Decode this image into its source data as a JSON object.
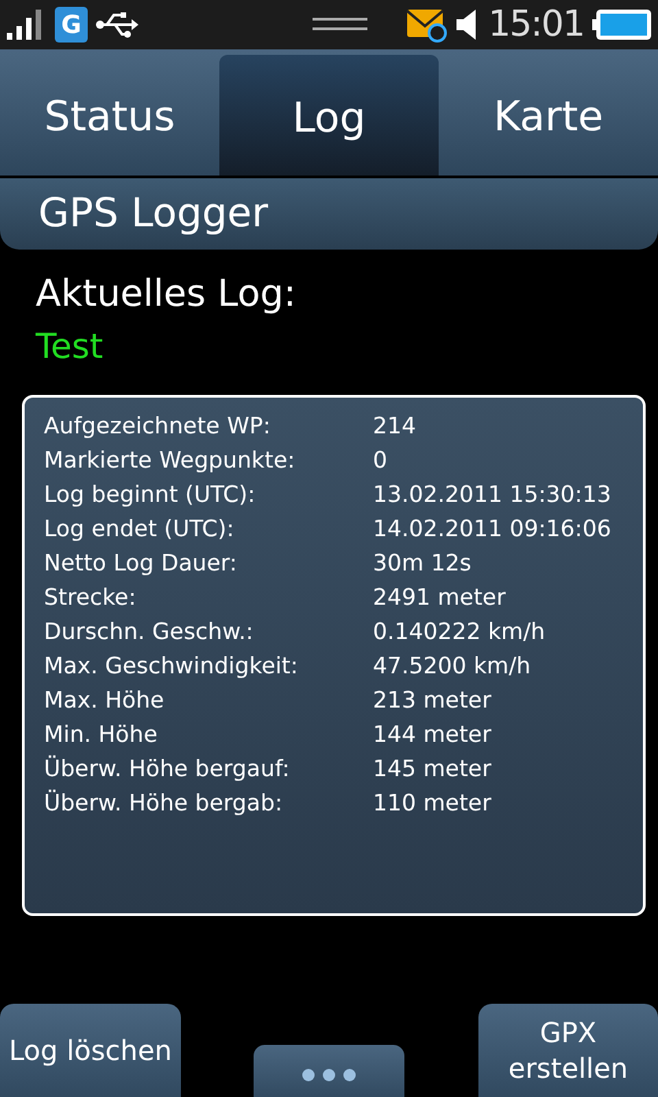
{
  "status_bar": {
    "network": "G",
    "time": "15:01"
  },
  "tabs": [
    {
      "label": "Status",
      "selected": false
    },
    {
      "label": "Log",
      "selected": true
    },
    {
      "label": "Karte",
      "selected": false
    }
  ],
  "title": "GPS Logger",
  "current_log": {
    "label": "Aktuelles Log:",
    "value": "Test"
  },
  "stats": [
    {
      "label": "Aufgezeichnete WP:",
      "value": "214"
    },
    {
      "label": "Markierte Wegpunkte:",
      "value": "0"
    },
    {
      "label": "Log beginnt (UTC):",
      "value": "13.02.2011 15:30:13"
    },
    {
      "label": "Log endet (UTC):",
      "value": "14.02.2011 09:16:06"
    },
    {
      "label": "Netto Log Dauer:",
      "value": "30m 12s"
    },
    {
      "label": "Strecke:",
      "value": "2491 meter"
    },
    {
      "label": "Durschn. Geschw.:",
      "value": "0.140222 km/h"
    },
    {
      "label": "Max. Geschwindigkeit:",
      "value": "47.5200 km/h"
    },
    {
      "label": "Max. Höhe",
      "value": "213 meter"
    },
    {
      "label": "Min. Höhe",
      "value": "144 meter"
    },
    {
      "label": "Überw. Höhe bergauf:",
      "value": "145 meter"
    },
    {
      "label": "Überw. Höhe bergab:",
      "value": "110 meter"
    }
  ],
  "buttons": [
    {
      "label": "Log löschen"
    },
    {
      "label": "GPX erstellen"
    }
  ]
}
